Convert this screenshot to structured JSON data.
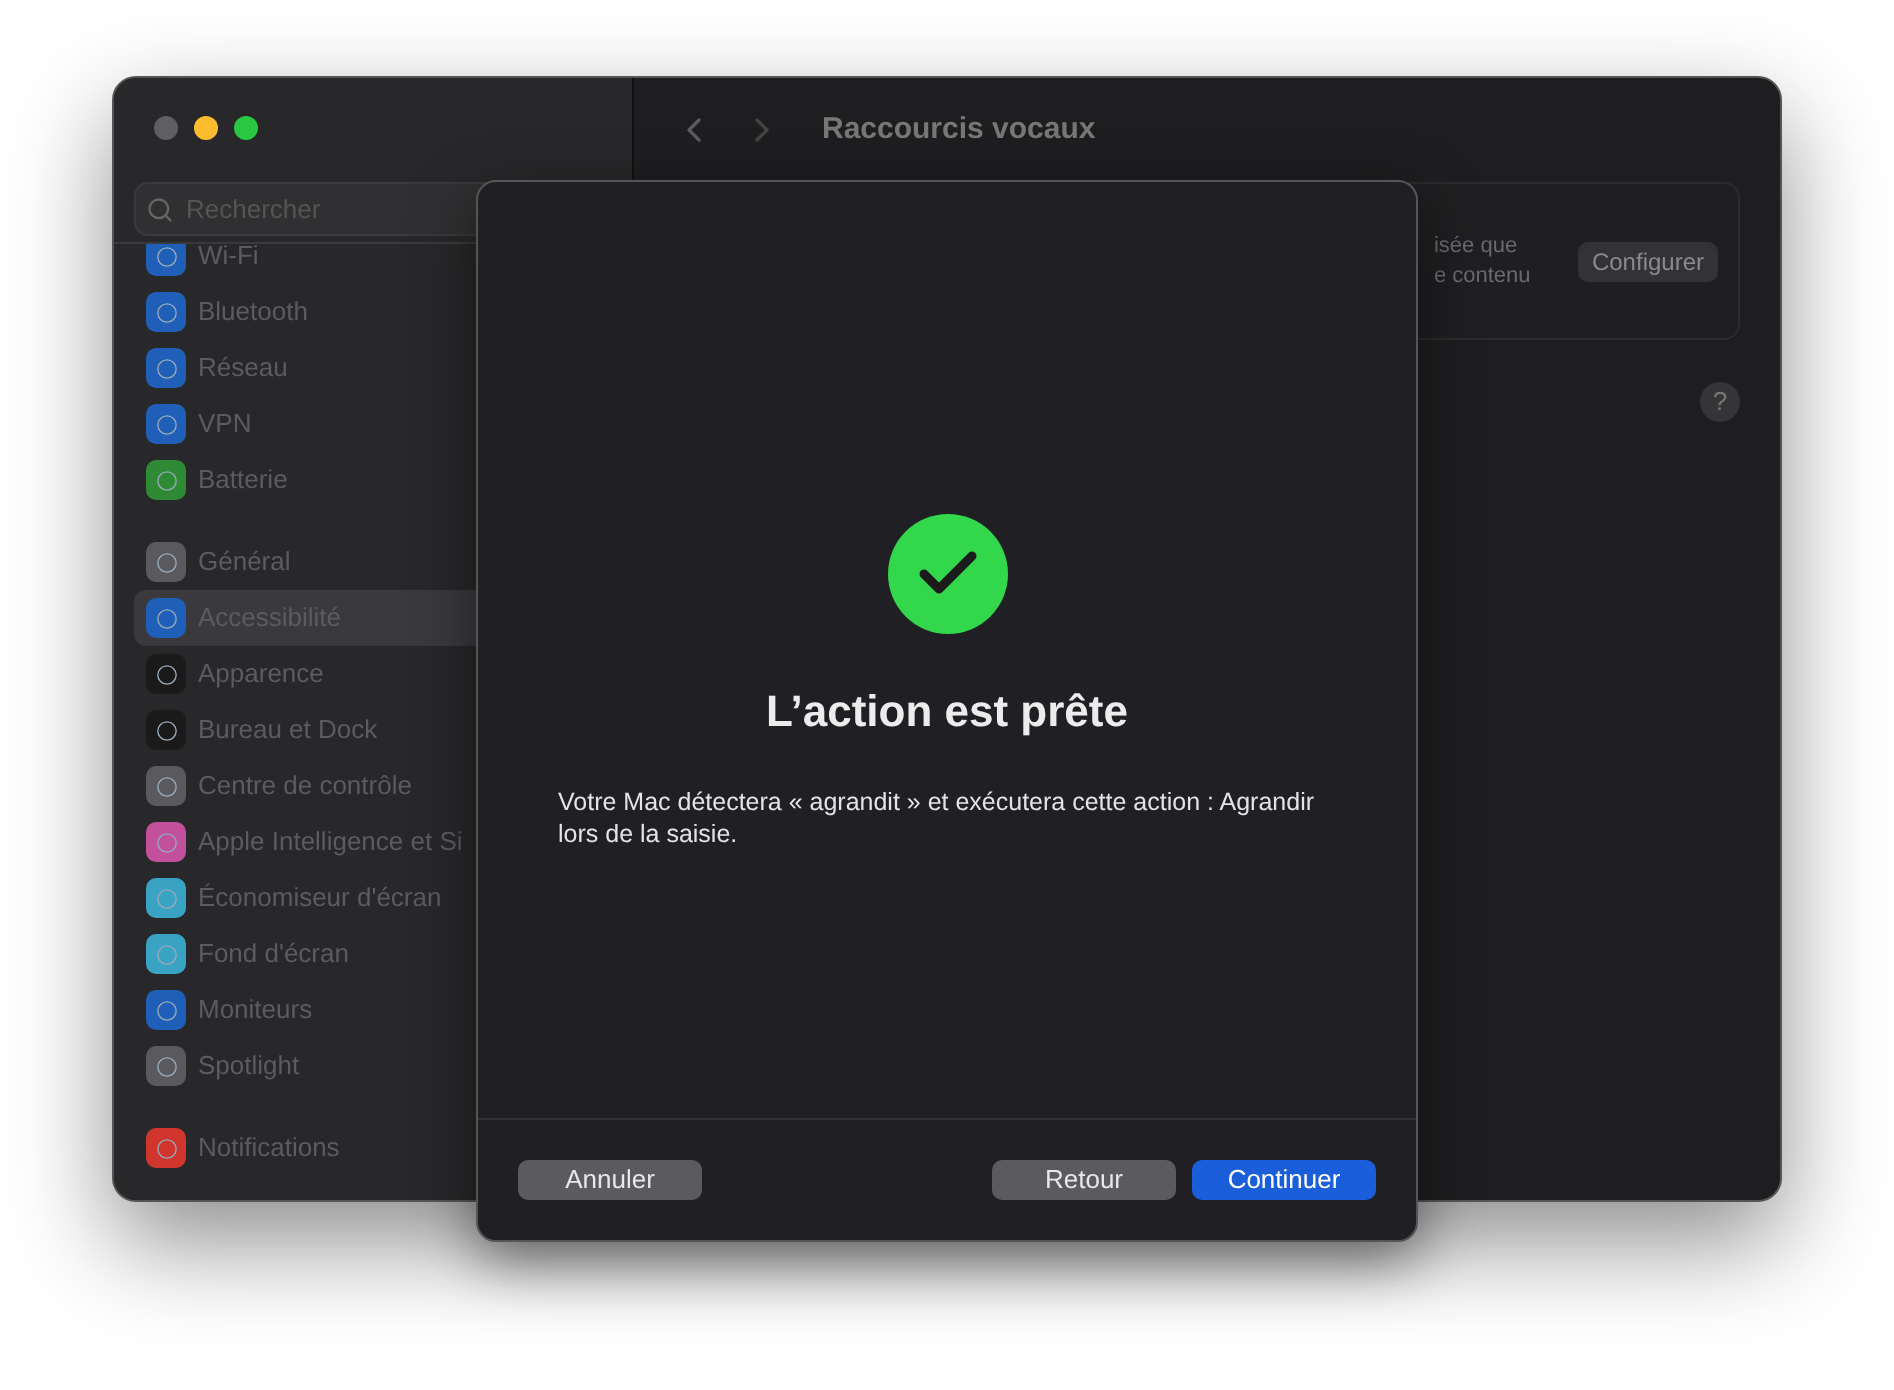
{
  "window": {
    "title": "Raccourcis vocaux"
  },
  "sidebar": {
    "search": {
      "placeholder": "Rechercher"
    },
    "groups": [
      [
        {
          "label": "Wi-Fi",
          "color": "#1f5fb8",
          "selected": false
        },
        {
          "label": "Bluetooth",
          "color": "#1f5fb8",
          "selected": false
        },
        {
          "label": "Réseau",
          "color": "#1f5fb8",
          "selected": false
        },
        {
          "label": "VPN",
          "color": "#1f5fb8",
          "selected": false
        },
        {
          "label": "Batterie",
          "color": "#2f8a36",
          "selected": false
        }
      ],
      [
        {
          "label": "Général",
          "color": "#5a5a5e",
          "selected": false
        },
        {
          "label": "Accessibilité",
          "color": "#1f5fb8",
          "selected": true
        },
        {
          "label": "Apparence",
          "color": "#1a1a1a",
          "selected": false
        },
        {
          "label": "Bureau et Dock",
          "color": "#1a1a1a",
          "selected": false
        },
        {
          "label": "Centre de contrôle",
          "color": "#5a5a5e",
          "selected": false
        },
        {
          "label": "Apple Intelligence et Si",
          "color": "#c2509a",
          "selected": false
        },
        {
          "label": "Économiseur d'écran",
          "color": "#3aa3c4",
          "selected": false
        },
        {
          "label": "Fond d'écran",
          "color": "#3aa3c4",
          "selected": false
        },
        {
          "label": "Moniteurs",
          "color": "#1f5fb8",
          "selected": false
        },
        {
          "label": "Spotlight",
          "color": "#5a5a5e",
          "selected": false
        }
      ],
      [
        {
          "label": "Notifications",
          "color": "#d0352e",
          "selected": false
        }
      ]
    ]
  },
  "content": {
    "card_lines": [
      "isée que",
      "e contenu"
    ],
    "card_button": "Configurer",
    "help": "?"
  },
  "dialog": {
    "title": "L’action est prête",
    "message": "Votre Mac détectera « agrandit » et exécutera cette action : Agrandir lors de la saisie.",
    "buttons": [
      {
        "label": "Annuler",
        "kind": "secondary"
      },
      {
        "label": "Retour",
        "kind": "secondary"
      },
      {
        "label": "Continuer",
        "kind": "primary"
      }
    ]
  }
}
